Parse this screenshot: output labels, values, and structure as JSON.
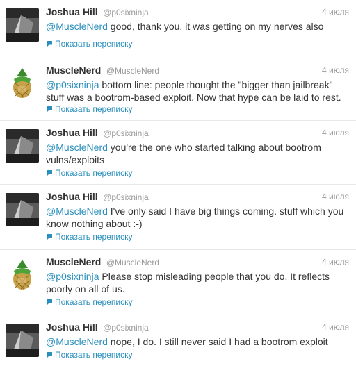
{
  "icons": {
    "conversation": "speech-bubble-icon"
  },
  "colors": {
    "link": "#2a8fbd",
    "meta": "#999999",
    "text": "#333333"
  },
  "tweets": [
    {
      "name": "Joshua Hill",
      "handle": "@p0sixninja",
      "time": "4 июля",
      "mention": "@MuscleNerd",
      "text": " good, thank you. it was getting on my nerves also",
      "conversation": "Показать переписку",
      "avatar": "p0sixninja"
    },
    {
      "name": "MuscleNerd",
      "handle": "@MuscleNerd",
      "time": "4 июля",
      "mention": "@p0sixninja",
      "text": " bottom line: people thought the \"bigger than jailbreak\" stuff was a bootrom-based exploit.  Now that hype can be laid to rest.",
      "conversation": "Показать переписку",
      "avatar": "musclenerd"
    },
    {
      "name": "Joshua Hill",
      "handle": "@p0sixninja",
      "time": "4 июля",
      "mention": "@MuscleNerd",
      "text": " you're the one who started talking about bootrom vulns/exploits",
      "conversation": "Показать переписку",
      "avatar": "p0sixninja"
    },
    {
      "name": "Joshua Hill",
      "handle": "@p0sixninja",
      "time": "4 июля",
      "mention": "@MuscleNerd",
      "text": " I've only said I have big things coming. stuff which you know nothing about :-)",
      "conversation": "Показать переписку",
      "avatar": "p0sixninja"
    },
    {
      "name": "MuscleNerd",
      "handle": "@MuscleNerd",
      "time": "4 июля",
      "mention": "@p0sixninja",
      "text": " Please stop misleading people that you do.  It reflects poorly on all of us.",
      "conversation": "Показать переписку",
      "avatar": "musclenerd"
    },
    {
      "name": "Joshua Hill",
      "handle": "@p0sixninja",
      "time": "4 июля",
      "mention": "@MuscleNerd",
      "text": " nope, I do. I still never said I had a bootrom exploit",
      "conversation": "Показать переписку",
      "avatar": "p0sixninja"
    }
  ]
}
